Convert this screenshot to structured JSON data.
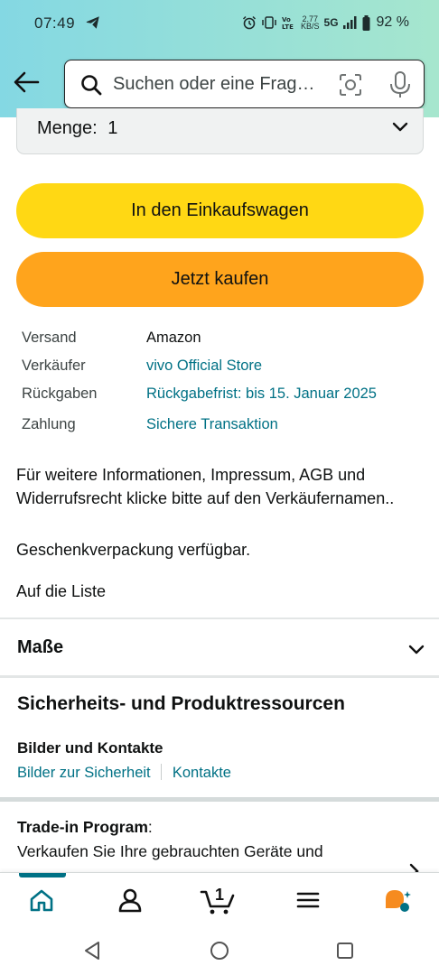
{
  "status_bar": {
    "time": "07:49",
    "speed_top": "2.77",
    "speed_bottom": "KB/S",
    "network": "5G",
    "battery": "92 %"
  },
  "search": {
    "placeholder": "Suchen oder eine Frag…"
  },
  "quantity": {
    "label": "Menge:",
    "value": "1"
  },
  "buttons": {
    "add_to_cart": "In den Einkaufswagen",
    "buy_now": "Jetzt kaufen"
  },
  "details": [
    {
      "label": "Versand",
      "value": "Amazon"
    },
    {
      "label": "Verkäufer",
      "value": "vivo Official Store"
    },
    {
      "label": "Rückgaben",
      "value": "Rückgabefrist: bis 15. Januar 2025"
    },
    {
      "label": "Zahlung",
      "value": "Sichere Transaktion"
    }
  ],
  "info_text": "Für weitere Informationen, Impressum, AGB und Widerrufsrecht klicke bitte auf den Verkäufernamen..",
  "gift_text": "Geschenkverpackung verfügbar.",
  "list_link": "Auf die Liste",
  "dimensions": {
    "title": "Maße"
  },
  "safety": {
    "title": "Sicherheits- und Produktressourcen",
    "subtitle": "Bilder und Kontakte",
    "link_images": "Bilder zur Sicherheit",
    "link_contacts": "Kontakte"
  },
  "trade_in": {
    "title": "Trade-in Program",
    "colon": ":",
    "text": "Verkaufen Sie Ihre gebrauchten Geräte und"
  },
  "bottom_nav": {
    "cart_count": "1",
    "accent_color": "#007185"
  }
}
